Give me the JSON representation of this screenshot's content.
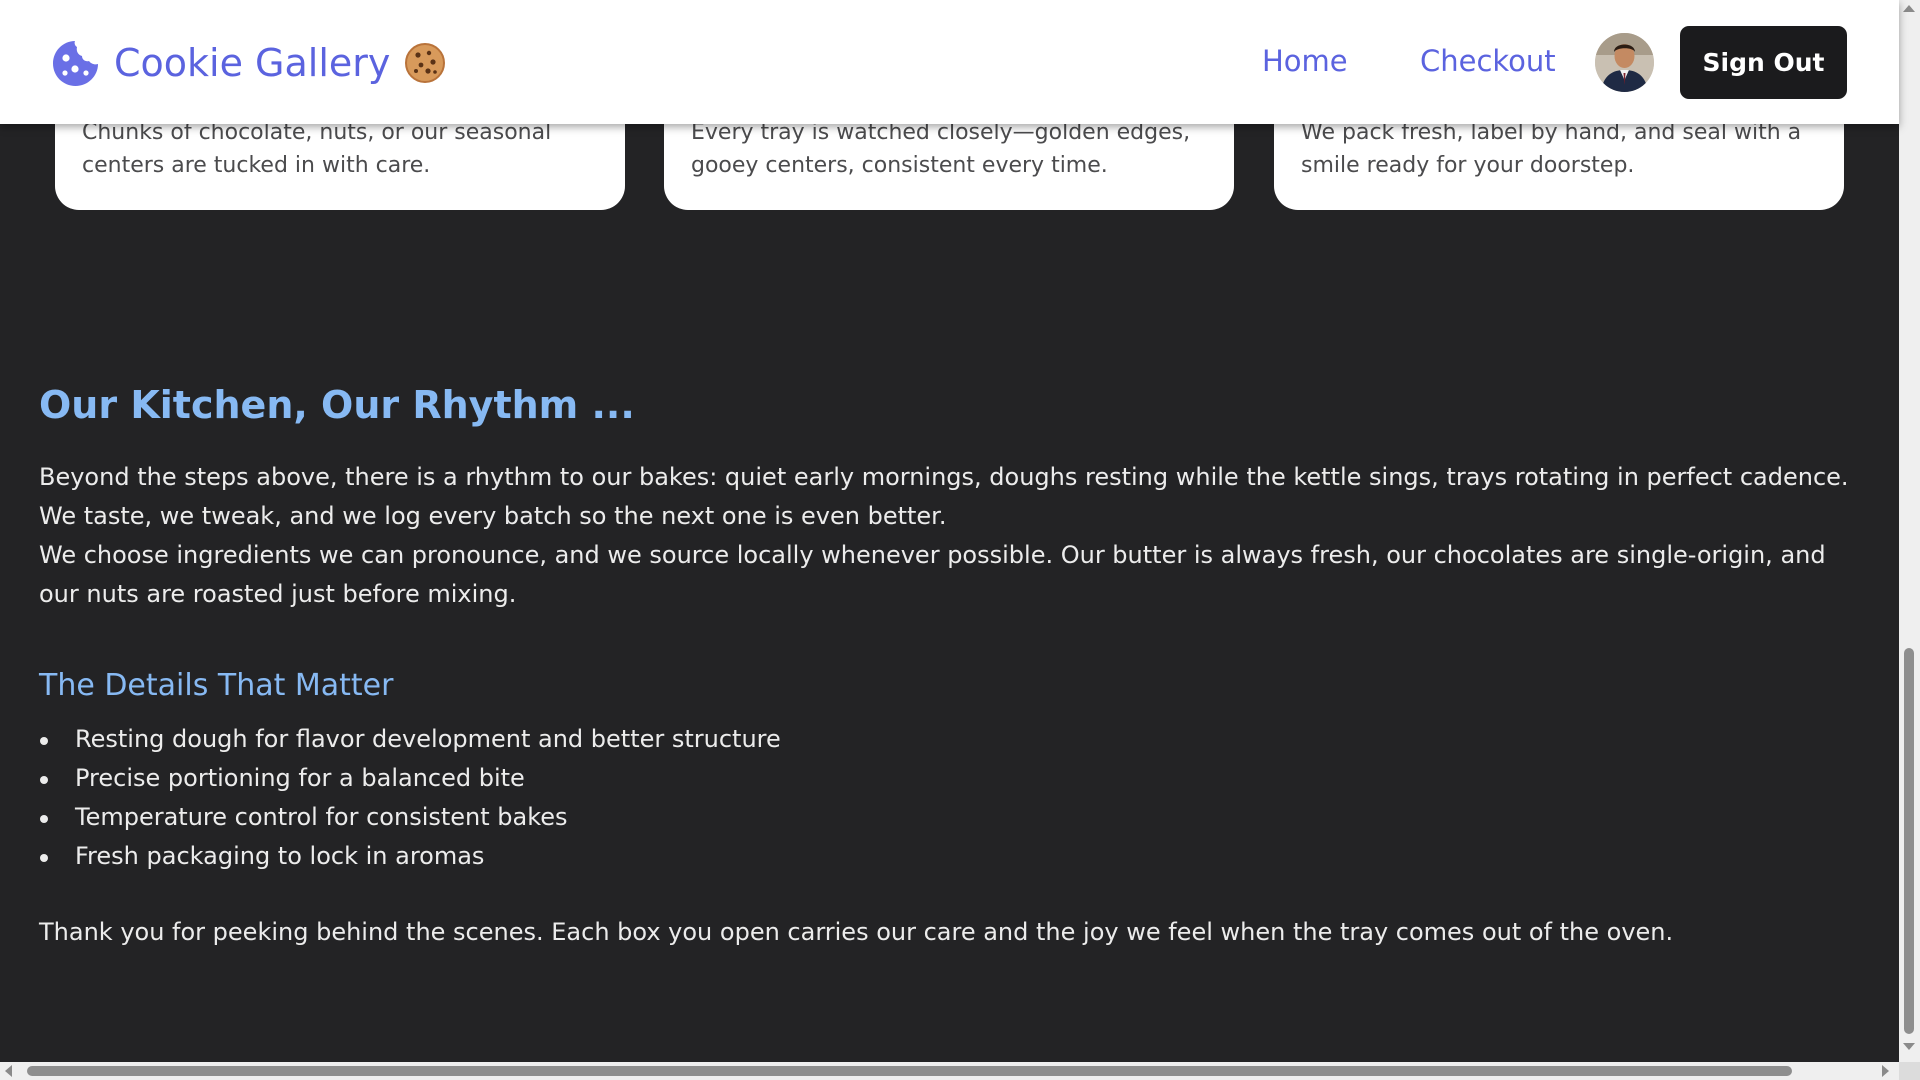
{
  "header": {
    "brand_name": "Cookie Gallery",
    "brand_logo_icon": "cookie-icon",
    "brand_emoji_icon": "cookie-emoji-icon",
    "brand_color": "#5b63df",
    "nav": [
      {
        "label": "Home"
      },
      {
        "label": "Checkout"
      }
    ],
    "avatar_icon": "user-avatar",
    "sign_out_label": "Sign Out"
  },
  "cards": [
    {
      "text": "Chunks of chocolate, nuts, or our seasonal centers are tucked in with care."
    },
    {
      "text": "Every tray is watched closely—golden edges, gooey centers, consistent every time."
    },
    {
      "text": "We pack fresh, label by hand, and seal with a smile ready for your doorstep."
    }
  ],
  "content": {
    "title": "Our Kitchen, Our Rhythm ...",
    "para_1": "Beyond the steps above, there is a rhythm to our bakes: quiet early mornings, doughs resting while the kettle sings, trays rotating in perfect cadence. We taste, we tweak, and we log every batch so the next one is even better.",
    "para_2": "We choose ingredients we can pronounce, and we source locally whenever possible. Our butter is always fresh, our chocolates are single-origin, and our nuts are roasted just before mixing.",
    "subtitle": "The Details That Matter",
    "details": [
      "Resting dough for flavor development and better structure",
      "Precise portioning for a balanced bite",
      "Temperature control for consistent bakes",
      "Fresh packaging to lock in aromas"
    ],
    "closing": "Thank you for peeking behind the scenes. Each box you open carries our care and the joy we feel when the tray comes out of the oven."
  },
  "theme": {
    "page_background": "#232325",
    "heading_color": "#87b9f3",
    "button_background": "#1b1b1d"
  }
}
